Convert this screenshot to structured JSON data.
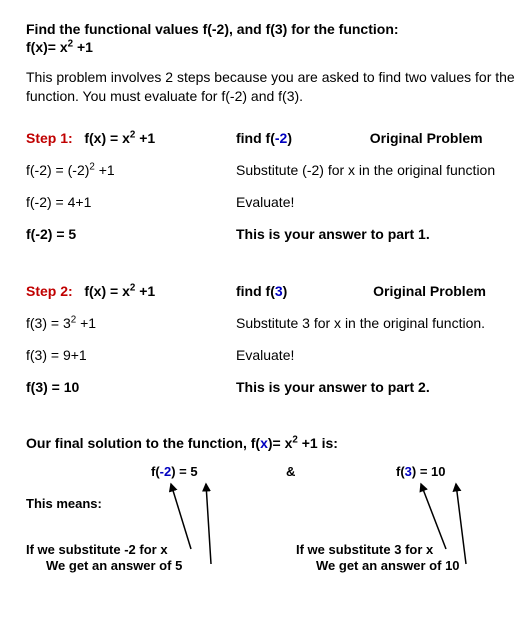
{
  "intro": {
    "title_a": "Find the functional values f(-2),  and f(3) for the function:",
    "title_b1": " f(x)= x",
    "title_b_sup": "2",
    "title_b2": " +1",
    "para": "This problem involves 2 steps because you are asked to find two values for the function.  You must evaluate for f(-2) and f(3)."
  },
  "step1": {
    "label": "Step 1:",
    "eq_a": "f(x) = x",
    "eq_sup": "2",
    "eq_b": " +1",
    "find_a": "find f(",
    "find_arg": "-2",
    "find_b": ")",
    "orig": "Original Problem",
    "r1a1": "f(-2) = (-2)",
    "r1a_sup": "2",
    "r1a2": "  +1",
    "r1b": "Substitute (-2) for x in the original function",
    "r2a": "f(-2) = 4+1",
    "r2b": "Evaluate!",
    "r3a": "f(-2) = 5",
    "r3b": "This is your answer to part 1."
  },
  "step2": {
    "label": "Step 2:",
    "eq_a": "f(x) = x",
    "eq_sup": "2",
    "eq_b": " +1",
    "find_a": "find f(",
    "find_arg": "3",
    "find_b": ")",
    "orig": "Original Problem",
    "r1a1": "f(3) = 3",
    "r1a_sup": "2",
    "r1a2": "  +1",
    "r1b": "Substitute 3 for x in the original function.",
    "r2a": "f(3) = 9+1",
    "r2b": "Evaluate!",
    "r3a": "f(3) = 10",
    "r3b": "This is your answer to part 2."
  },
  "final": {
    "intro_a": "Our final solution to the function, f(",
    "intro_x": "x",
    "intro_b": ")= x",
    "intro_sup": "2",
    "intro_c": " +1 is:",
    "left_a": "f(",
    "left_arg": "-2",
    "left_b": ") = 5",
    "amp": "&",
    "right_a": "f(",
    "right_arg": "3",
    "right_b": ") = 10",
    "means": "This means:",
    "left_c1": "If we substitute  -2 for x",
    "left_c2": "We get an answer of 5",
    "right_c1": "If we substitute 3 for x",
    "right_c2": "We get an answer of 10"
  },
  "chart_data": {
    "type": "table",
    "function": "f(x) = x^2 + 1",
    "inputs": [
      -2,
      3
    ],
    "outputs": [
      5,
      10
    ]
  }
}
